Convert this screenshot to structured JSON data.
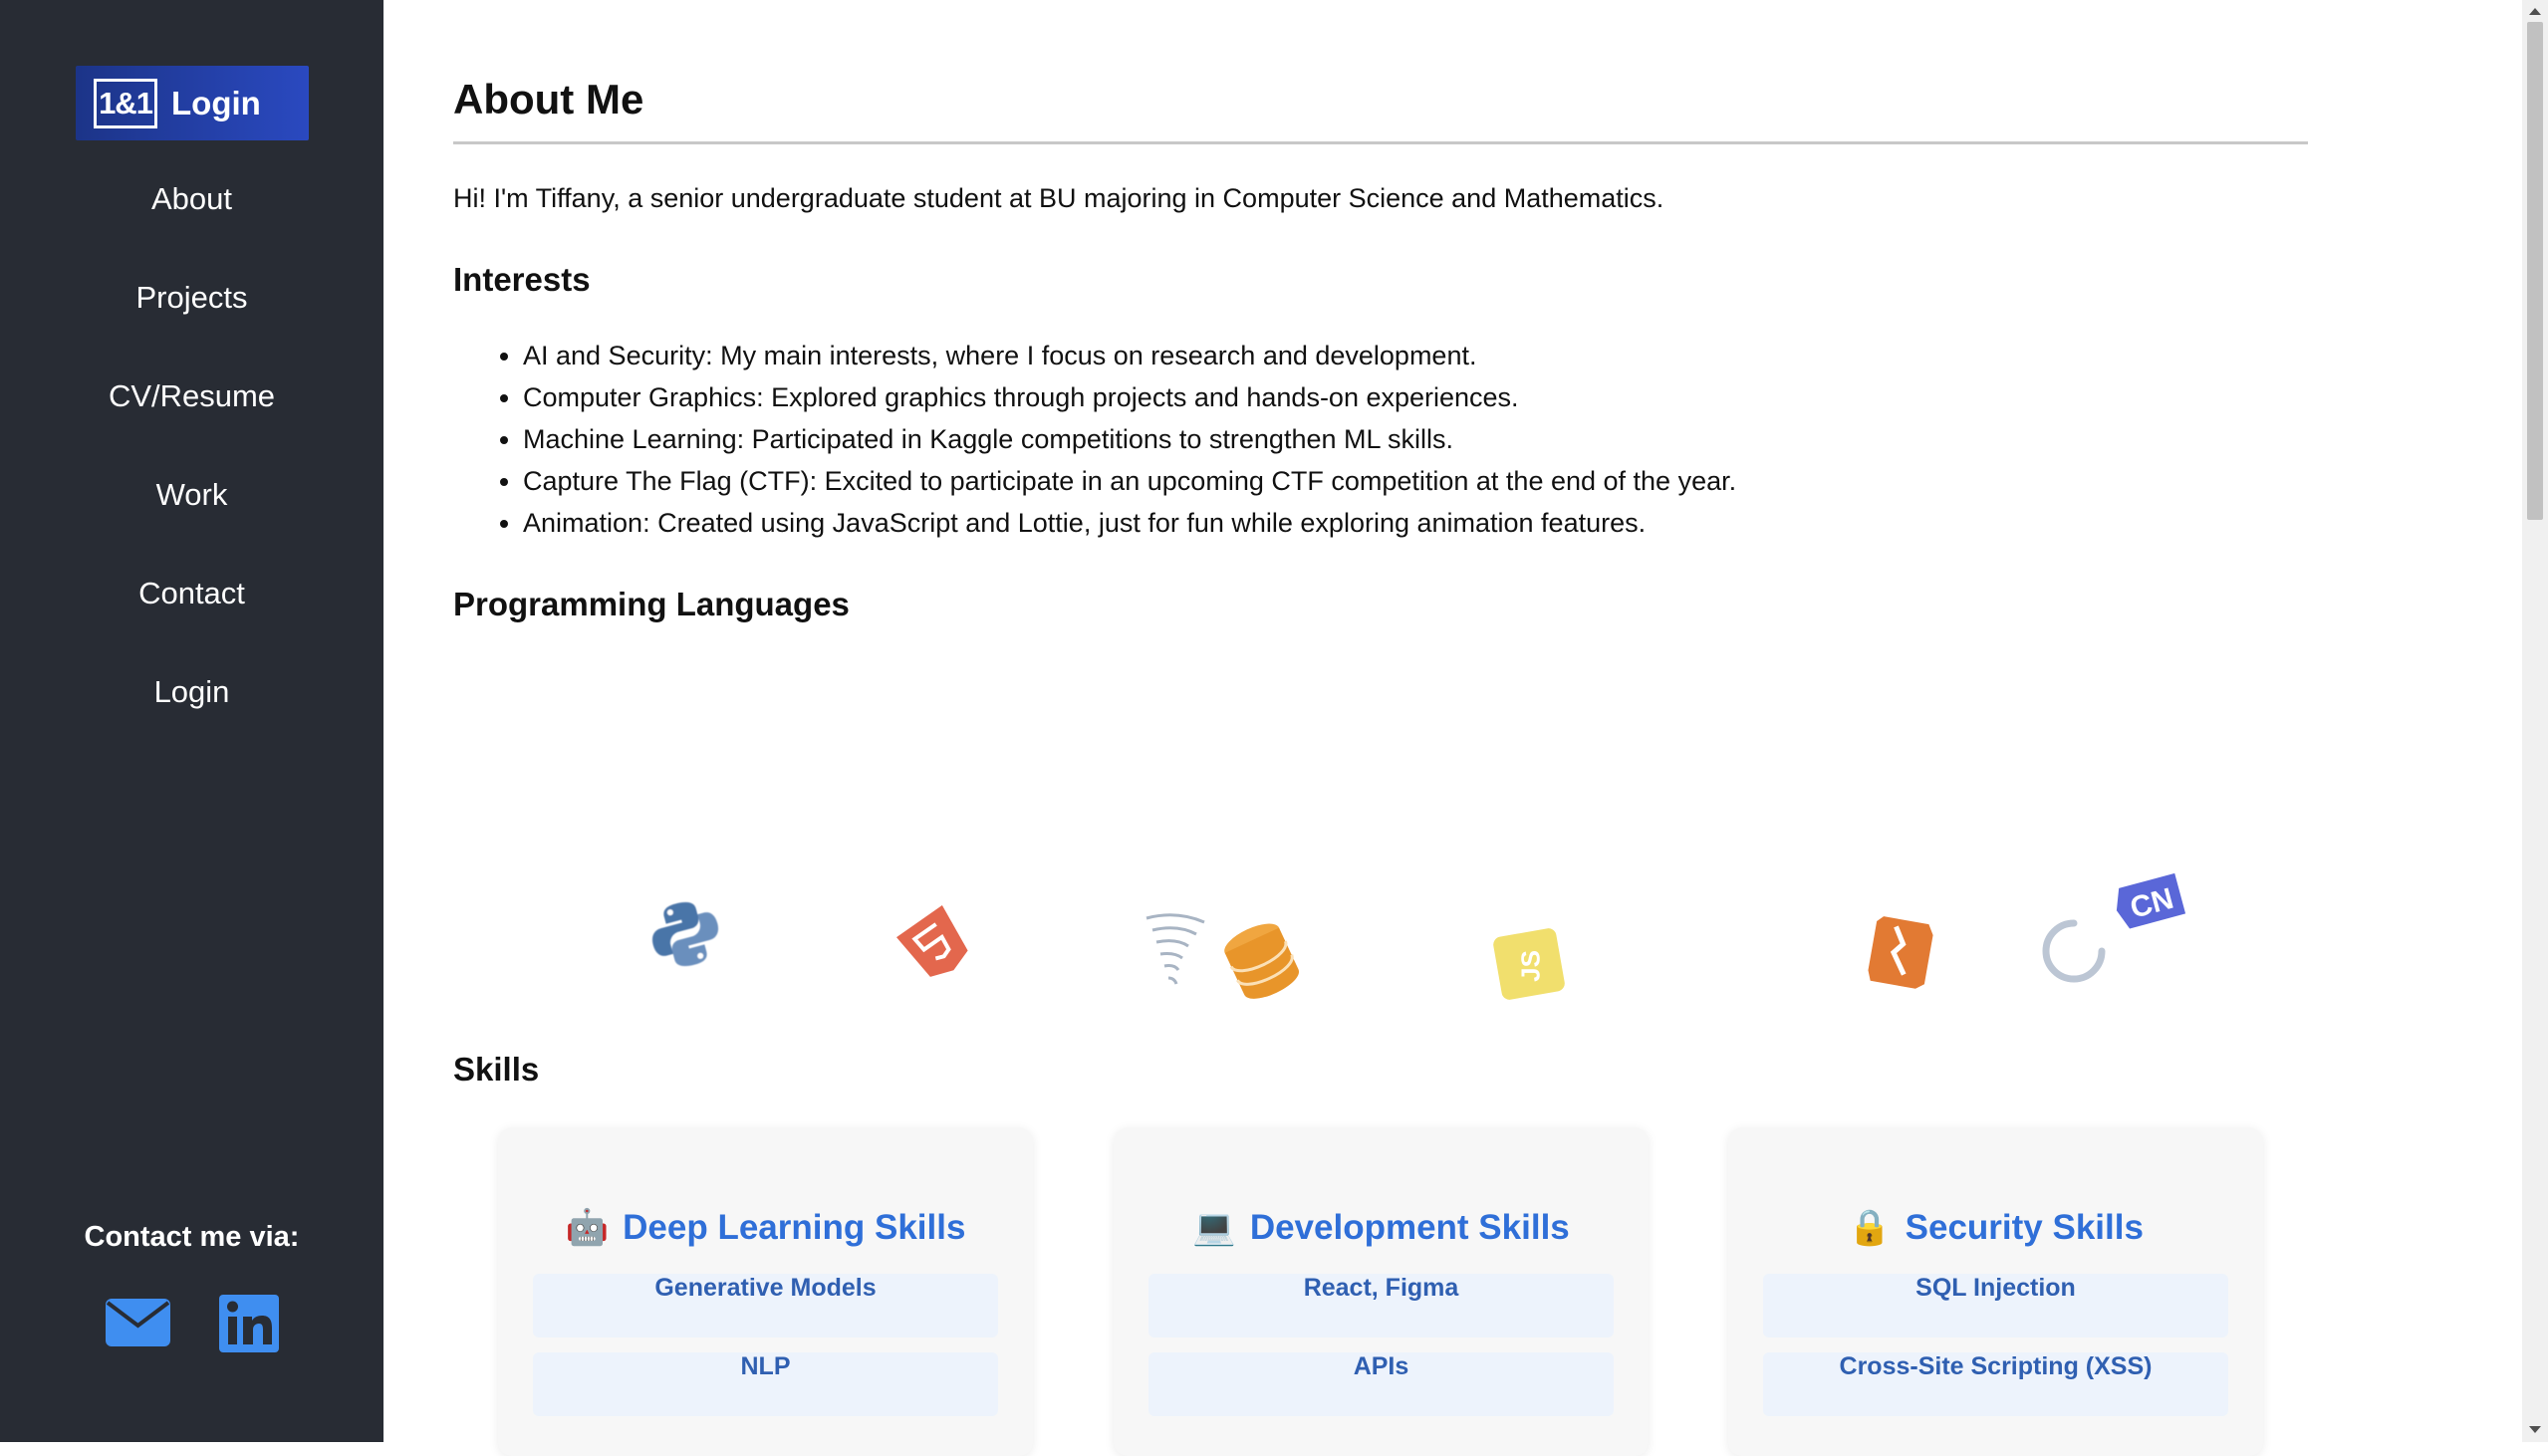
{
  "sidebar": {
    "logo": {
      "mark": "1&1",
      "text": "Login"
    },
    "nav": [
      "About",
      "Projects",
      "CV/Resume",
      "Work",
      "Contact",
      "Login"
    ],
    "contact_title": "Contact me via:",
    "icons": [
      "mail-icon",
      "linkedin-icon"
    ]
  },
  "main": {
    "title": "About Me",
    "intro": "Hi! I'm Tiffany, a senior undergraduate student at BU majoring in Computer Science and Mathematics.",
    "interests_heading": "Interests",
    "interests": [
      "AI and Security: My main interests, where I focus on research and development.",
      "Computer Graphics: Explored graphics through projects and hands-on experiences.",
      "Machine Learning: Participated in Kaggle competitions to strengthen ML skills.",
      "Capture The Flag (CTF): Excited to participate in an upcoming CTF competition at the end of the year.",
      "Animation: Created using JavaScript and Lottie, just for fun while exploring animation features."
    ],
    "languages_heading": "Programming Languages",
    "language_icons": [
      "python-icon",
      "html5-icon",
      "tornado-icon",
      "database-icon",
      "javascript-icon",
      "svelte-icon",
      "loading-icon",
      "c-lang-icon"
    ],
    "skills_heading": "Skills",
    "skills": [
      {
        "emoji": "🤖",
        "title": "Deep Learning Skills",
        "items": [
          "Generative Models",
          "NLP"
        ]
      },
      {
        "emoji": "💻",
        "title": "Development Skills",
        "items": [
          "React, Figma",
          "APIs"
        ]
      },
      {
        "emoji": "🔒",
        "title": "Security Skills",
        "items": [
          "SQL Injection",
          "Cross-Site Scripting (XSS)"
        ]
      }
    ]
  },
  "colors": {
    "sidebar_bg": "#282c34",
    "accent": "#2f6fd8",
    "chip_bg": "#edf3fc"
  }
}
